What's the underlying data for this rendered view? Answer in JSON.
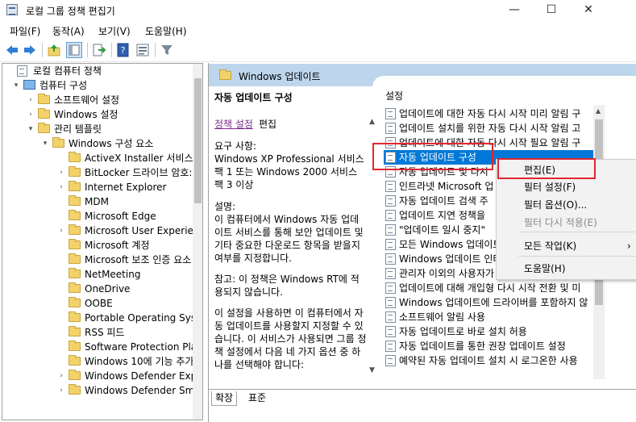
{
  "window": {
    "title": "로컬 그룹 정책 편집기",
    "minimize_glyph": "—",
    "maximize_glyph": "☐",
    "close_glyph": "✕"
  },
  "menu": [
    "파일(F)",
    "동작(A)",
    "보기(V)",
    "도움말(H)"
  ],
  "toolbar_icons": [
    "back-arrow-icon",
    "forward-arrow-icon",
    "up-folder-icon",
    "show-hide-tree-icon",
    "export-list-icon",
    "help-icon",
    "properties-icon",
    "filter-icon"
  ],
  "tree": {
    "items": [
      {
        "label": "로컬 컴퓨터 정책",
        "level": 0,
        "arrow": "",
        "icon": "doc"
      },
      {
        "label": "컴퓨터 구성",
        "level": 1,
        "arrow": "▾",
        "icon": "pc"
      },
      {
        "label": "소프트웨어 설정",
        "level": 2,
        "arrow": "›",
        "icon": "folder"
      },
      {
        "label": "Windows 설정",
        "level": 2,
        "arrow": "›",
        "icon": "folder"
      },
      {
        "label": "관리 템플릿",
        "level": 2,
        "arrow": "▾",
        "icon": "folder"
      },
      {
        "label": "Windows 구성 요소",
        "level": 3,
        "arrow": "▾",
        "icon": "folder"
      },
      {
        "label": "ActiveX Installer 서비스",
        "level": 4,
        "arrow": "",
        "icon": "folder"
      },
      {
        "label": "BitLocker 드라이브 암호:",
        "level": 4,
        "arrow": "›",
        "icon": "folder"
      },
      {
        "label": "Internet Explorer",
        "level": 4,
        "arrow": "›",
        "icon": "folder"
      },
      {
        "label": "MDM",
        "level": 4,
        "arrow": "",
        "icon": "folder"
      },
      {
        "label": "Microsoft Edge",
        "level": 4,
        "arrow": "",
        "icon": "folder"
      },
      {
        "label": "Microsoft User Experienc",
        "level": 4,
        "arrow": "›",
        "icon": "folder"
      },
      {
        "label": "Microsoft 계정",
        "level": 4,
        "arrow": "",
        "icon": "folder"
      },
      {
        "label": "Microsoft 보조 인증 요소",
        "level": 4,
        "arrow": "",
        "icon": "folder"
      },
      {
        "label": "NetMeeting",
        "level": 4,
        "arrow": "",
        "icon": "folder"
      },
      {
        "label": "OneDrive",
        "level": 4,
        "arrow": "",
        "icon": "folder"
      },
      {
        "label": "OOBE",
        "level": 4,
        "arrow": "",
        "icon": "folder"
      },
      {
        "label": "Portable Operating Syste",
        "level": 4,
        "arrow": "",
        "icon": "folder"
      },
      {
        "label": "RSS 피드",
        "level": 4,
        "arrow": "",
        "icon": "folder"
      },
      {
        "label": "Software Protection Platf",
        "level": 4,
        "arrow": "",
        "icon": "folder"
      },
      {
        "label": "Windows 10에 기능 추가",
        "level": 4,
        "arrow": "",
        "icon": "folder"
      },
      {
        "label": "Windows Defender Explo",
        "level": 4,
        "arrow": "›",
        "icon": "folder"
      },
      {
        "label": "Windows Defender Sma",
        "level": 4,
        "arrow": "›",
        "icon": "folder"
      }
    ]
  },
  "right": {
    "header_title": "Windows 업데이트",
    "description": {
      "title": "자동 업데이트 구성",
      "link": "정책 설정",
      "link_suffix": "편집",
      "requirements": "요구 사항:\nWindows XP Professional 서비스 팩 1 또는 Windows 2000 서비스 팩 3 이상",
      "explain": "설명:\n이 컴퓨터에서 Windows 자동 업데이트 서비스를 통해 보안 업데이트 및 기타 중요한 다운로드 항목을 받을지 여부를 지정합니다.",
      "note": "참고: 이 정책은 Windows RT에 적용되지 않습니다.",
      "more": "이 설정을 사용하면 이 컴퓨터에서 자동 업데이트를 사용할지 지정할 수 있습니다. 이 서비스가 사용되면 그룹 정책 설정에서 다음 네 가지 옵션 중 하나를 선택해야 합니다:"
    },
    "list_header": "설정",
    "settings": [
      "업데이트에 대한 자동 다시 시작 미리 알림 구",
      "업데이트 설치를 위한 자동 다시 시작 알림 고",
      "업데이트에 대한 자동 다시 시작 필요 알림 구",
      "자동 업데이트 구성",
      "자동 업데이트 및 다시",
      "인트라넷 Microsoft 업",
      "자동 업데이트 검색 주",
      "업데이트 지연 정책을",
      "\"업데이트 일시 중지\"",
      "모든 Windows 업데이트",
      "Windows 업데이트 인터",
      "관리자 이외의 사용자가",
      "업데이트에 대해 개입형 다시 시작 전환 및 미",
      "Windows 업데이트에 드라이버를 포함하지 않",
      "소프트웨어 알림 사용",
      "자동 업데이트로 바로 설치 허용",
      "자동 업데이트를 통한 권장 업데이트 설정",
      "예약된 자동 업데이트 설치 시 로그온한 사용"
    ],
    "selected_index": 3
  },
  "tabs": [
    "확장",
    "표준"
  ],
  "context_menu": {
    "items": [
      {
        "label": "편집(E)",
        "disabled": false
      },
      {
        "label": "필터 설정(F)",
        "disabled": false
      },
      {
        "label": "필터 옵션(O)...",
        "disabled": false
      },
      {
        "label": "필터 다시 적용(E)",
        "disabled": true
      },
      {
        "label": "모든 작업(K)",
        "disabled": false,
        "submenu": "›"
      },
      {
        "label": "도움말(H)",
        "disabled": false
      }
    ]
  },
  "colors": {
    "selection": "#0078d7",
    "header_band": "#bdd6ec",
    "highlight": "#e3262f",
    "disabled_text": "#8a8a8a",
    "link": "#7a2e8a"
  }
}
